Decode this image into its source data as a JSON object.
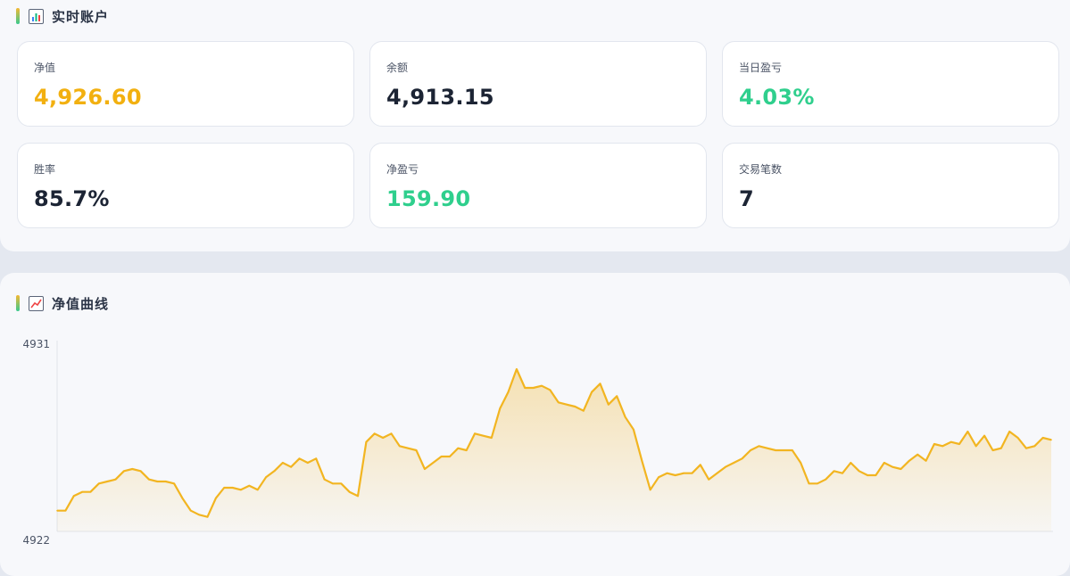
{
  "account": {
    "title": "实时账户",
    "icon": "bar-chart-icon",
    "stats": [
      {
        "label": "净值",
        "value": "4,926.60",
        "color": "#f2b010"
      },
      {
        "label": "余额",
        "value": "4,913.15",
        "color": "#1c2434"
      },
      {
        "label": "当日盈亏",
        "value": "4.03%",
        "color": "#2fcf8d"
      },
      {
        "label": "胜率",
        "value": "85.7%",
        "color": "#1c2434"
      },
      {
        "label": "净盈亏",
        "value": "159.90",
        "color": "#2fcf8d"
      },
      {
        "label": "交易笔数",
        "value": "7",
        "color": "#1c2434"
      }
    ]
  },
  "equity_chart": {
    "title": "净值曲线",
    "icon": "line-chart-icon",
    "line_color": "#f2b521"
  },
  "chart_data": {
    "type": "area",
    "title": "",
    "xlabel": "",
    "ylabel": "",
    "ylim": [
      4922,
      4931
    ],
    "y_ticks": [
      "4931",
      "4922"
    ],
    "grid": false,
    "series": [
      {
        "values": [
          4923.0,
          4923.0,
          4923.7,
          4923.9,
          4923.9,
          4924.3,
          4924.4,
          4924.5,
          4924.9,
          4925.0,
          4924.9,
          4924.5,
          4924.4,
          4924.4,
          4924.3,
          4923.6,
          4923.0,
          4922.8,
          4922.7,
          4923.6,
          4924.1,
          4924.1,
          4924.0,
          4924.2,
          4924.0,
          4924.6,
          4924.9,
          4925.3,
          4925.1,
          4925.5,
          4925.3,
          4925.5,
          4924.5,
          4924.3,
          4924.3,
          4923.9,
          4923.7,
          4926.3,
          4926.7,
          4926.5,
          4926.7,
          4926.1,
          4926.0,
          4925.9,
          4925.0,
          4925.3,
          4925.6,
          4925.6,
          4926.0,
          4925.9,
          4926.7,
          4926.6,
          4926.5,
          4927.9,
          4928.7,
          4929.8,
          4928.9,
          4928.9,
          4929.0,
          4928.8,
          4928.2,
          4928.1,
          4928.0,
          4927.8,
          4928.7,
          4929.1,
          4928.1,
          4928.5,
          4927.5,
          4926.9,
          4925.4,
          4924.0,
          4924.6,
          4924.8,
          4924.7,
          4924.8,
          4924.8,
          4925.2,
          4924.5,
          4924.8,
          4925.1,
          4925.3,
          4925.5,
          4925.9,
          4926.1,
          4926.0,
          4925.9,
          4925.9,
          4925.9,
          4925.3,
          4924.3,
          4924.3,
          4924.5,
          4924.9,
          4924.8,
          4925.3,
          4924.9,
          4924.7,
          4924.7,
          4925.3,
          4925.1,
          4925.0,
          4925.4,
          4925.7,
          4925.4,
          4926.2,
          4926.1,
          4926.3,
          4926.2,
          4926.8,
          4926.1,
          4926.6,
          4925.9,
          4926.0,
          4926.8,
          4926.5,
          4926.0,
          4926.1,
          4926.5,
          4926.4
        ]
      }
    ]
  }
}
